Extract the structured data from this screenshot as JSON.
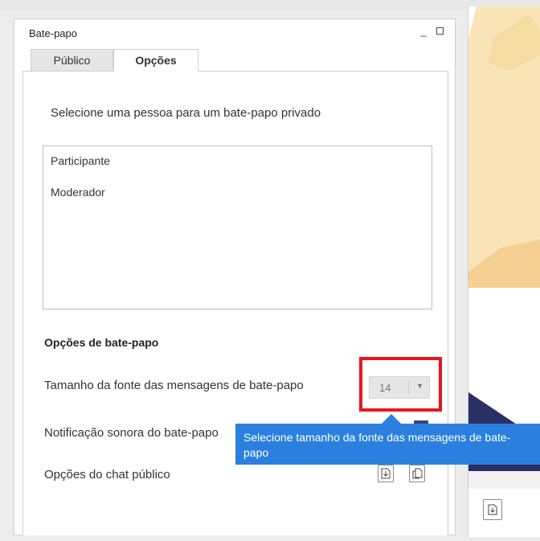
{
  "window": {
    "title": "Bate-papo",
    "minimize_glyph": "_",
    "maximize_icon": "square-icon"
  },
  "tabs": [
    {
      "label": "Público",
      "active": false
    },
    {
      "label": "Opções",
      "active": true
    }
  ],
  "private_chat": {
    "prompt": "Selecione uma pessoa para um bate-papo privado",
    "people": [
      "Participante",
      "Moderador"
    ]
  },
  "chat_options": {
    "heading": "Opções de bate-papo",
    "font_size_label": "Tamanho da fonte das mensagens de bate-papo",
    "font_size_value": "14",
    "sound_label": "Notificação sonora do bate-papo",
    "sound_enabled": true,
    "public_options_label": "Opções do chat público"
  },
  "tooltip": {
    "text": "Selecione tamanho da fonte das mensagens de bate-papo"
  },
  "icons": [
    "download-icon",
    "copy-icon",
    "dropdown-arrow-icon"
  ],
  "colors": {
    "highlight": "#e8151d",
    "tooltip": "#2b80df",
    "checkbox": "#2e3f8a",
    "slide_background": "#f9e4b7"
  }
}
